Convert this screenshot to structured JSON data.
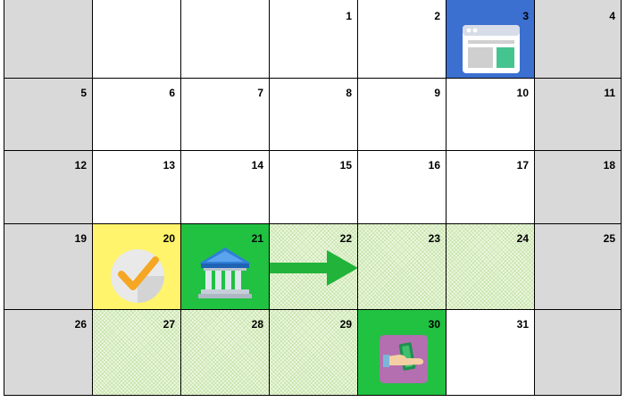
{
  "calendar": {
    "rows": [
      {
        "cells": [
          {
            "day": "",
            "type": "weekend"
          },
          {
            "day": "",
            "type": "empty"
          },
          {
            "day": "",
            "type": "empty"
          },
          {
            "day": "1",
            "type": "normal"
          },
          {
            "day": "2",
            "type": "normal"
          },
          {
            "day": "3",
            "type": "blue",
            "icon": "browser-window-icon"
          },
          {
            "day": "4",
            "type": "weekend"
          }
        ]
      },
      {
        "cells": [
          {
            "day": "5",
            "type": "weekend"
          },
          {
            "day": "6",
            "type": "normal"
          },
          {
            "day": "7",
            "type": "normal"
          },
          {
            "day": "8",
            "type": "normal"
          },
          {
            "day": "9",
            "type": "normal"
          },
          {
            "day": "10",
            "type": "normal"
          },
          {
            "day": "11",
            "type": "weekend"
          }
        ]
      },
      {
        "cells": [
          {
            "day": "12",
            "type": "weekend"
          },
          {
            "day": "13",
            "type": "normal"
          },
          {
            "day": "14",
            "type": "normal"
          },
          {
            "day": "15",
            "type": "normal"
          },
          {
            "day": "16",
            "type": "normal"
          },
          {
            "day": "17",
            "type": "normal"
          },
          {
            "day": "18",
            "type": "weekend"
          }
        ]
      },
      {
        "cells": [
          {
            "day": "19",
            "type": "weekend"
          },
          {
            "day": "20",
            "type": "yellow",
            "icon": "checkmark-icon"
          },
          {
            "day": "21",
            "type": "green",
            "icon": "bank-icon"
          },
          {
            "day": "22",
            "type": "hatch",
            "icon": "right-arrow-icon"
          },
          {
            "day": "23",
            "type": "hatch"
          },
          {
            "day": "24",
            "type": "hatch"
          },
          {
            "day": "25",
            "type": "weekend"
          }
        ]
      },
      {
        "cells": [
          {
            "day": "26",
            "type": "weekend"
          },
          {
            "day": "27",
            "type": "hatch"
          },
          {
            "day": "28",
            "type": "hatch"
          },
          {
            "day": "29",
            "type": "hatch"
          },
          {
            "day": "30",
            "type": "green",
            "icon": "cash-hand-icon"
          },
          {
            "day": "31",
            "type": "normal"
          },
          {
            "day": "",
            "type": "weekend"
          }
        ]
      }
    ]
  },
  "colors": {
    "weekend": "#d9d9d9",
    "highlight_green": "#21c142",
    "highlight_yellow": "#fff46b",
    "highlight_blue": "#3b6fd0",
    "hatch": "#eef8e0"
  }
}
